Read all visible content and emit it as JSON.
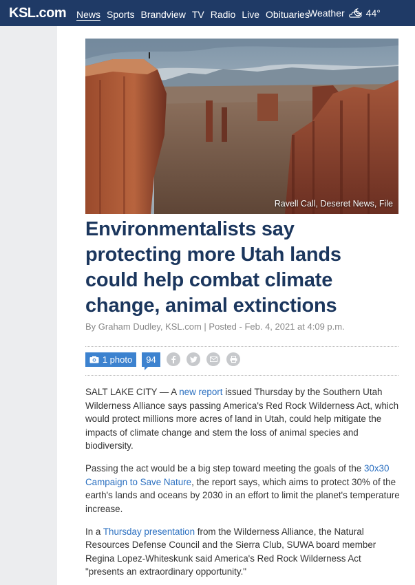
{
  "header": {
    "logo": "KSL.com",
    "nav": [
      "News",
      "Sports",
      "Brandview",
      "TV",
      "Radio",
      "Live",
      "Obituaries"
    ],
    "weather_label": "Weather",
    "weather_icon": "cloud-moon-icon",
    "temperature": "44°"
  },
  "hero": {
    "credit": "Ravell Call, Deseret News, File"
  },
  "article": {
    "headline": "Environmentalists say protecting more Utah lands could help combat climate change, animal extinctions",
    "byline": "By Graham Dudley, KSL.com | Posted - Feb. 4, 2021 at 4:09 p.m.",
    "photo_count": "1 photo",
    "comment_count": "94",
    "share_icons": [
      "facebook-icon",
      "twitter-icon",
      "email-icon",
      "print-icon"
    ],
    "p1_start": "SALT LAKE CITY — A ",
    "p1_link": "new report",
    "p1_end": " issued Thursday by the Southern Utah Wilderness Alliance says passing America's Red Rock Wilderness Act, which would protect millions more acres of land in Utah, could help mitigate the impacts of climate change and stem the loss of animal species and biodiversity.",
    "p2_start": "Passing the act would be a big step toward meeting the goals of the ",
    "p2_link": "30x30 Campaign to Save Nature",
    "p2_end": ", the report says, which aims to protect 30% of the earth's lands and oceans by 2030 in an effort to limit the planet's temperature increase.",
    "p3_start": "In a ",
    "p3_link": "Thursday presentation",
    "p3_end": " from the Wilderness Alliance, the Natural Resources Defense Council and the Sierra Club, SUWA board member Regina Lopez-Whiteskunk said America's Red Rock Wilderness Act \"presents an extraordinary opportunity.\""
  }
}
